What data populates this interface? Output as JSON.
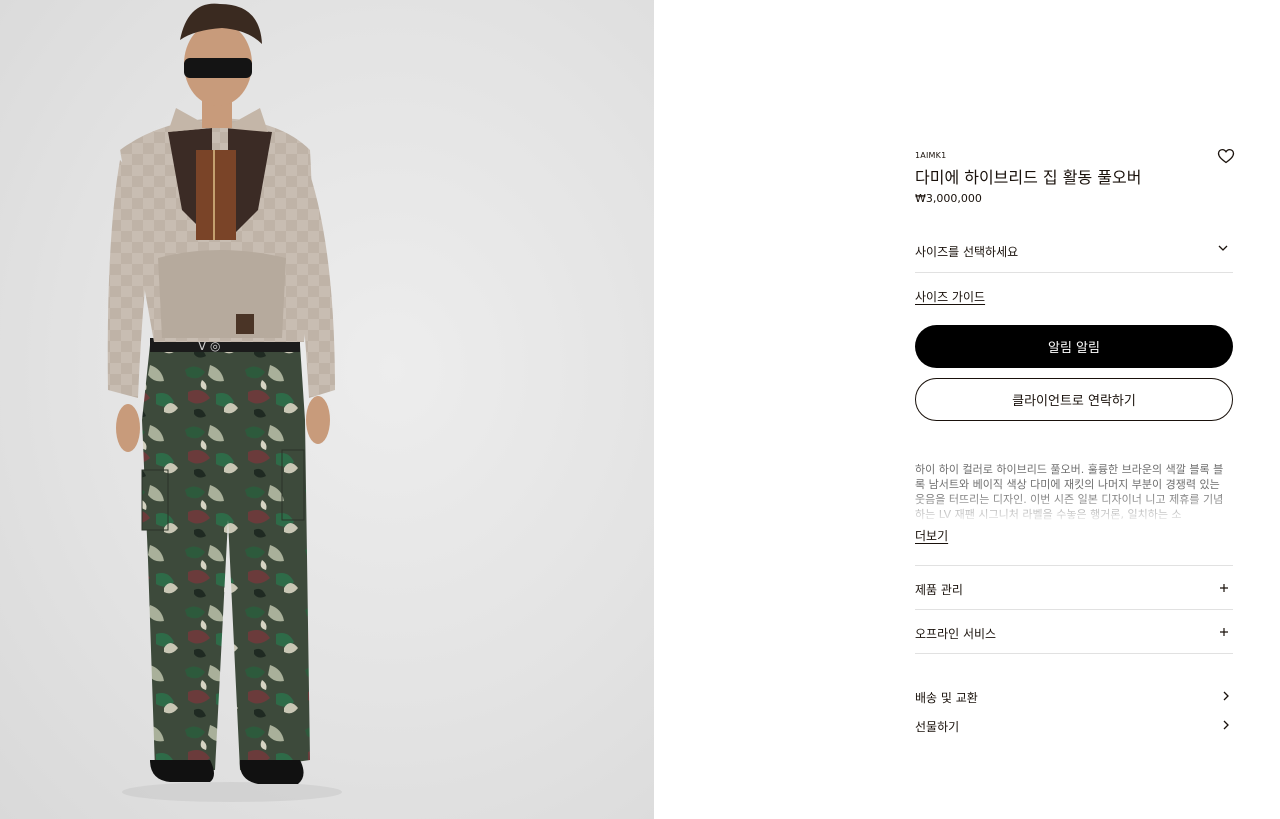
{
  "product": {
    "sku": "1AIMK1",
    "title": "다미에 하이브리드 집 활동 풀오버",
    "price": "₩3,000,000",
    "image_alt": "model wearing pullover and camouflage cargo pants"
  },
  "icons": {
    "wishlist": "heart-icon",
    "size_select": "chevron-down-icon",
    "accordion": "plus-icon",
    "link": "chevron-right-icon"
  },
  "size_select": {
    "placeholder": "사이즈를 선택하세요"
  },
  "size_guide": {
    "label": "사이즈 가이드"
  },
  "buttons": {
    "notify": "알림 알림",
    "contact": "클라이언트로 연락하기"
  },
  "description": {
    "text": "하이 하이 컬러로 하이브리드 풀오버. 훌륭한 브라운의 색깔 블록 블록 남서트와 베이직 색상 다미에 재킷의 나머지 부분이 경쟁력 있는 웃음을 터뜨리는 디자인. 이번 시즌 일본 디자이너 니고 제휴를 기념하는 LV 재팬 시그니처 라벨을 수놓은 행거론, 일치하는 소",
    "more_label": "더보기"
  },
  "accordions": [
    {
      "label": "제품 관리"
    },
    {
      "label": "오프라인 서비스"
    }
  ],
  "links": [
    {
      "label": "배송 및 교환"
    },
    {
      "label": "선물하기"
    }
  ],
  "colors": {
    "text": "#19110b",
    "primary_button": "#000000",
    "divider": "#e1e1e1",
    "muted": "#6f6f6f"
  }
}
